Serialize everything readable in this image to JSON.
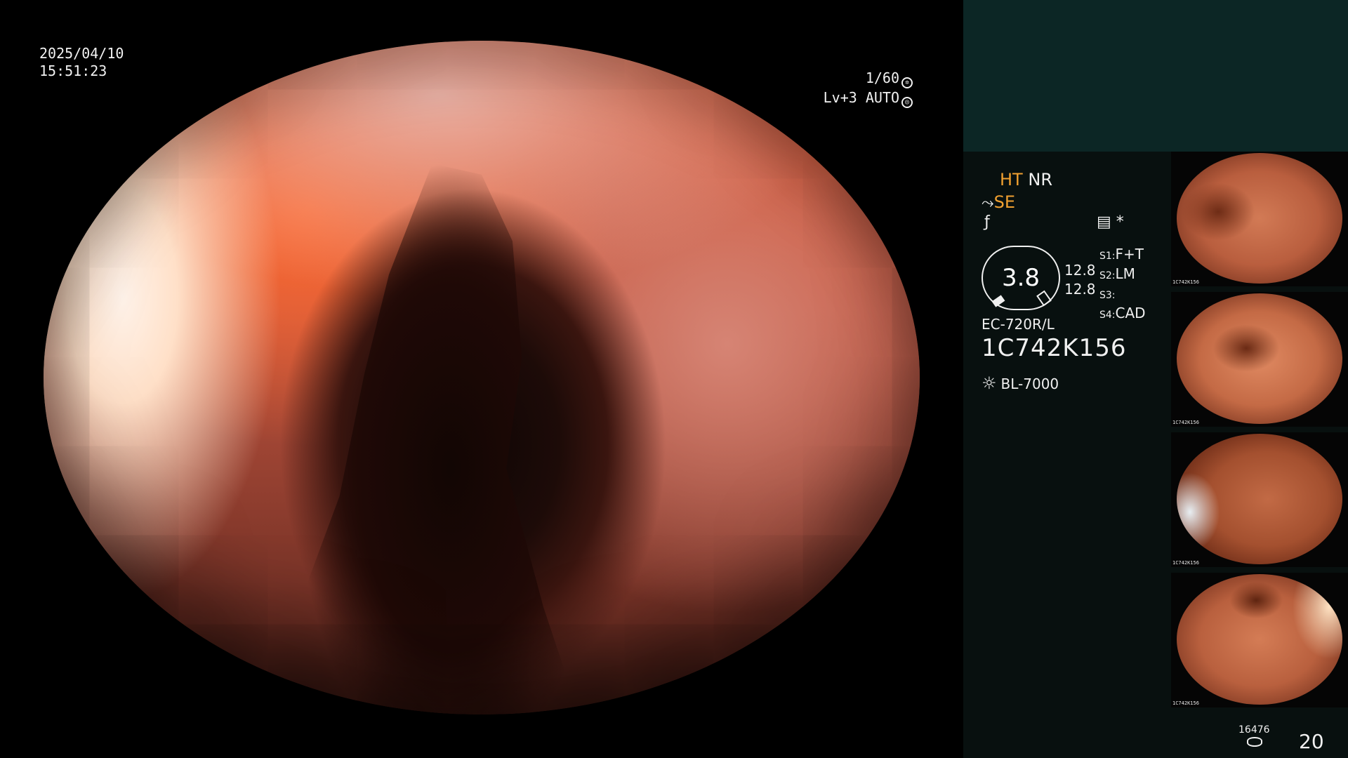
{
  "overlay": {
    "date": "2025/04/10",
    "time": "15:51:23",
    "shutter": "1/60",
    "level": "Lv+3 AUTO"
  },
  "panel": {
    "ht": "HT",
    "nr": "NR",
    "se": "SE",
    "se_icon": "structure-enhance-icon",
    "arb_icon": "f-curve-icon",
    "mode_icon": "image-mode-icon",
    "star": "*",
    "intensity": "3.8",
    "value1": "12.8",
    "value2": "12.8",
    "slots": [
      {
        "key": "S1:",
        "value": "F+T"
      },
      {
        "key": "S2:",
        "value": "LM"
      },
      {
        "key": "S3:",
        "value": ""
      },
      {
        "key": "S4:",
        "value": "CAD"
      }
    ],
    "scope_model": "EC-720R/L",
    "scope_serial": "1C742K156",
    "light_icon": "light-source-icon",
    "light_source": "BL-7000",
    "capture_count_small": "16476",
    "capture_count": "20"
  },
  "thumbnails": [
    {
      "label": "1C742K156"
    },
    {
      "label": "1C742K156"
    },
    {
      "label": "1C742K156"
    },
    {
      "label": "1C742K156"
    }
  ],
  "colors": {
    "panel_bg": "#08100f",
    "panel_top": "#0c2625",
    "accent_orange": "#f0a030"
  }
}
